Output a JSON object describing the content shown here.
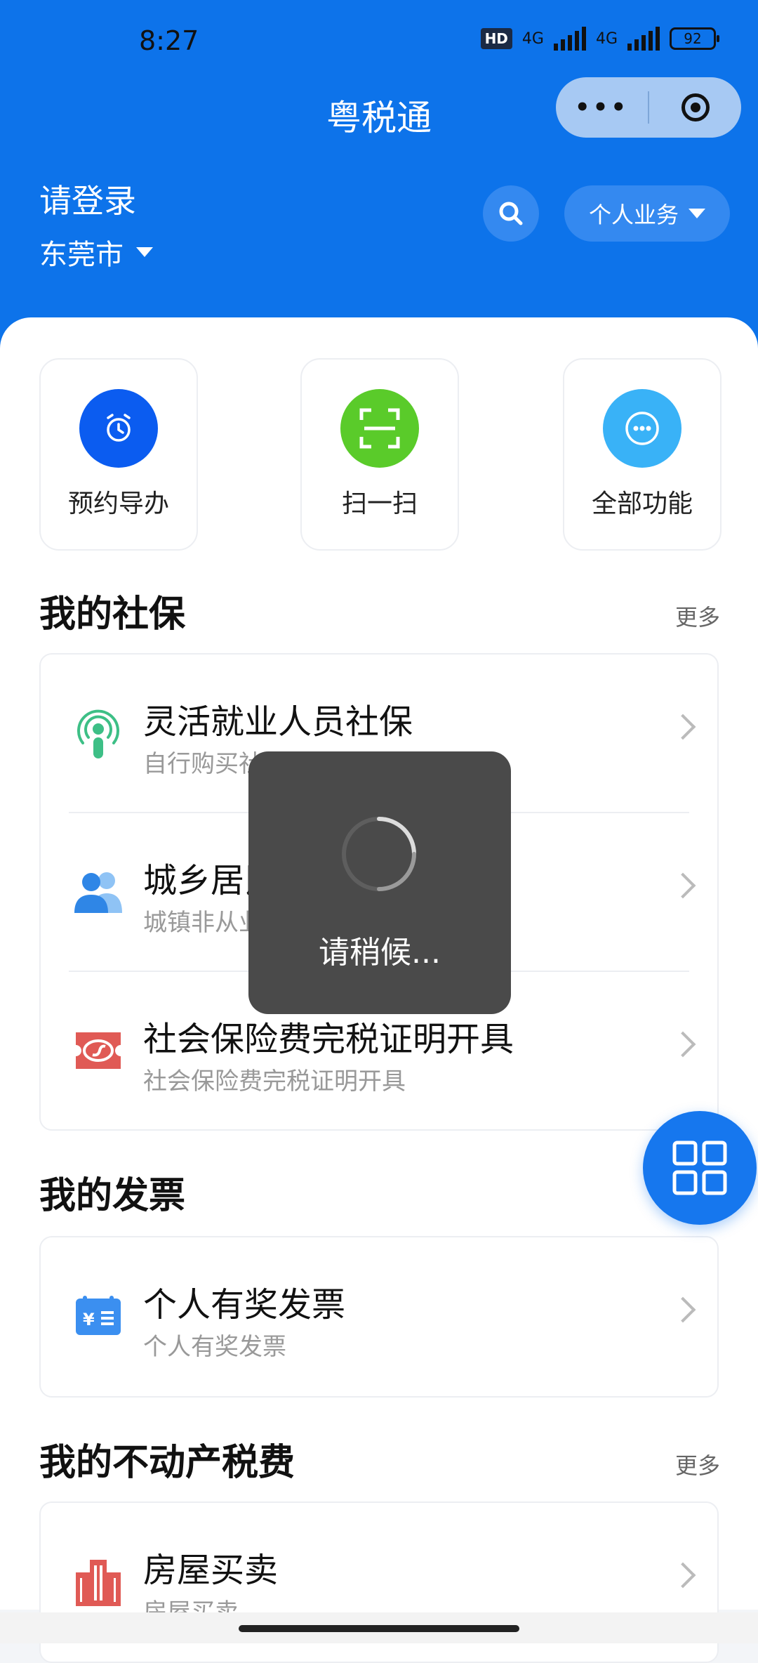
{
  "status_bar": {
    "time": "8:27",
    "hd": "HD",
    "net1": "4G",
    "net2": "4G",
    "battery": "92"
  },
  "header": {
    "title": "粤税通",
    "login_prompt": "请登录",
    "city": "东莞市",
    "business_dropdown": "个人业务"
  },
  "capsule": {
    "more_icon": "more-dots-icon",
    "close_icon": "target-icon"
  },
  "quick_actions": [
    {
      "label": "预约导办",
      "icon": "alarm-clock-icon",
      "color": "#0b5cf0"
    },
    {
      "label": "扫一扫",
      "icon": "scan-icon",
      "color": "#5acb2a"
    },
    {
      "label": "全部功能",
      "icon": "more-circle-icon",
      "color": "#39b2f7"
    }
  ],
  "social_security": {
    "title": "我的社保",
    "more": "更多",
    "items": [
      {
        "title": "灵活就业人员社保",
        "subtitle": "自行购买社保",
        "icon": "podcast-person-icon"
      },
      {
        "title": "城乡居民社保",
        "subtitle": "城镇非从业人员社保",
        "icon": "people-icon"
      },
      {
        "title": "社会保险费完税证明开具",
        "subtitle": "社会保险费完税证明开具",
        "icon": "si-ticket-icon"
      }
    ]
  },
  "invoice": {
    "title": "我的发票",
    "items": [
      {
        "title": "个人有奖发票",
        "subtitle": "个人有奖发票",
        "icon": "yuan-ticket-icon"
      }
    ]
  },
  "property": {
    "title": "我的不动产税费",
    "more": "更多",
    "items": [
      {
        "title": "房屋买卖",
        "subtitle": "房屋买卖",
        "icon": "building-icon"
      }
    ]
  },
  "toast": {
    "text": "请稍候..."
  },
  "colors": {
    "header": "#0d73ea",
    "accent": "#1677ee"
  }
}
